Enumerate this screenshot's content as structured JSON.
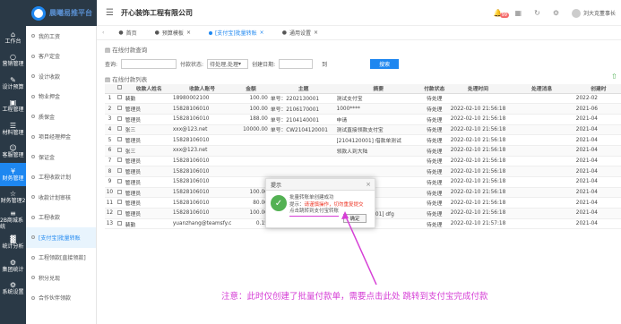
{
  "app": {
    "logo_text": "晨曦易推平台",
    "company": "开心装饰工程有限公司",
    "badge": "99",
    "user": "刘大克董事长"
  },
  "leftbar": [
    {
      "icon": "⌂",
      "label": "工作台"
    },
    {
      "icon": "○",
      "label": "营销管理"
    },
    {
      "icon": "✎",
      "label": "设计预算"
    },
    {
      "icon": "▣",
      "label": "工程管理"
    },
    {
      "icon": "☰",
      "label": "材料管理"
    },
    {
      "icon": "☺",
      "label": "客服管理"
    },
    {
      "icon": "¥",
      "label": "财务管理"
    },
    {
      "icon": "☆",
      "label": "财务管理2"
    },
    {
      "icon": "≡",
      "label": "2B商城系统"
    },
    {
      "icon": "▓",
      "label": "统计分析"
    },
    {
      "icon": "⚙",
      "label": "集团统计"
    },
    {
      "icon": "⚙",
      "label": "系统设置"
    }
  ],
  "submenu": [
    "我的工资",
    "客户定金",
    "设计收款",
    "物业押金",
    "质保金",
    "项目经理押金",
    "保证金",
    "工程收款计划",
    "收款计划审核",
    "工程收款",
    "[支付宝]批量转账",
    "工程领款[直接领款]",
    "积分兑现",
    "合作伙伴领款"
  ],
  "tabs": [
    "首页",
    "预算模板",
    "[支付宝]批量转账",
    "通用设置"
  ],
  "sections": {
    "query": "在线付款查询",
    "list": "在线付款列表"
  },
  "search": {
    "query_label": "查询:",
    "status_label": "付款状态:",
    "status_value": "待处理,处理",
    "date_label": "创建日期:",
    "date_to": "到",
    "button": "搜索"
  },
  "table": {
    "headers": [
      "",
      "",
      "收款人姓名",
      "收款人账号",
      "金额",
      "主题",
      "摘要",
      "付款状态",
      "处理时间",
      "处理消息",
      "创建时"
    ],
    "rows": [
      [
        "1",
        "裴勤",
        "18980002100",
        "100.00",
        "单号：2202130001",
        "测试支付宝",
        "待处理",
        "",
        "",
        "2022-02"
      ],
      [
        "2",
        "管理员",
        "15828106010",
        "100.00",
        "单号：2106170001",
        "1000****",
        "待处理",
        "2022-02-10 21:56:18",
        "",
        "2021-06"
      ],
      [
        "3",
        "管理员",
        "15828106010",
        "188.00",
        "单号：2104140001",
        "申请",
        "待处理",
        "2022-02-10 21:56:18",
        "",
        "2021-04"
      ],
      [
        "4",
        "张三",
        "xxx@123.net",
        "10000.00",
        "单号：CW2104120001",
        "测试直接领款支付宝",
        "待处理",
        "2022-02-10 21:56:18",
        "",
        "2021-04"
      ],
      [
        "5",
        "管理员",
        "15828106010",
        "",
        "",
        "[2104120001] 借款单测试",
        "待处理",
        "2022-02-10 21:56:18",
        "",
        "2021-04"
      ],
      [
        "6",
        "张三",
        "xxx@123.net",
        "",
        "",
        "领款人到大陆",
        "待处理",
        "2022-02-10 21:56:18",
        "",
        "2021-04"
      ],
      [
        "7",
        "管理员",
        "15828106010",
        "",
        "",
        "",
        "待处理",
        "2022-02-10 21:56:18",
        "",
        "2021-04"
      ],
      [
        "8",
        "管理员",
        "15828106010",
        "",
        "",
        "",
        "待处理",
        "2022-02-10 21:56:18",
        "",
        "2021-04"
      ],
      [
        "9",
        "管理员",
        "15828106010",
        "",
        "",
        "",
        "待处理",
        "2022-02-10 21:56:18",
        "",
        "2021-04"
      ],
      [
        "10",
        "管理员",
        "15828106010",
        "100.00",
        "单号：2104110001",
        "领款单1",
        "待处理",
        "2022-02-10 21:56:18",
        "",
        "2021-04"
      ],
      [
        "11",
        "管理员",
        "15828106010",
        "80.00",
        "单号：2104090001",
        "测试",
        "待处理",
        "2022-02-10 21:56:18",
        "",
        "2021-04"
      ],
      [
        "12",
        "管理员",
        "15828106010",
        "100.00",
        "单号：2104090001",
        "借款[2104090001] dfg",
        "待处理",
        "2022-02-10 21:56:18",
        "",
        "2021-04"
      ],
      [
        "13",
        "裴勤",
        "yuanzhang@teamsfy.c",
        "0.15",
        "单号：CW2104040001",
        "这是测试信息",
        "待处理",
        "2022-02-10 21:57:18",
        "",
        "2021-04"
      ]
    ]
  },
  "modal": {
    "title": "提示",
    "line1": "批量转账单创建成功",
    "line2_prefix": "提示：",
    "line2_red": "请谨慎操作，切勿重复提交",
    "line3": "点击跳转到支付宝转账",
    "ok": "确定"
  },
  "note": "注意：此时仅创建了批量付款单，需要点击此处 跳转到支付宝完成付款",
  "colors": {
    "accent": "#1e87f0",
    "sidebar_dark": "#2a3946",
    "note": "#d63fd6",
    "success": "#53b153"
  }
}
